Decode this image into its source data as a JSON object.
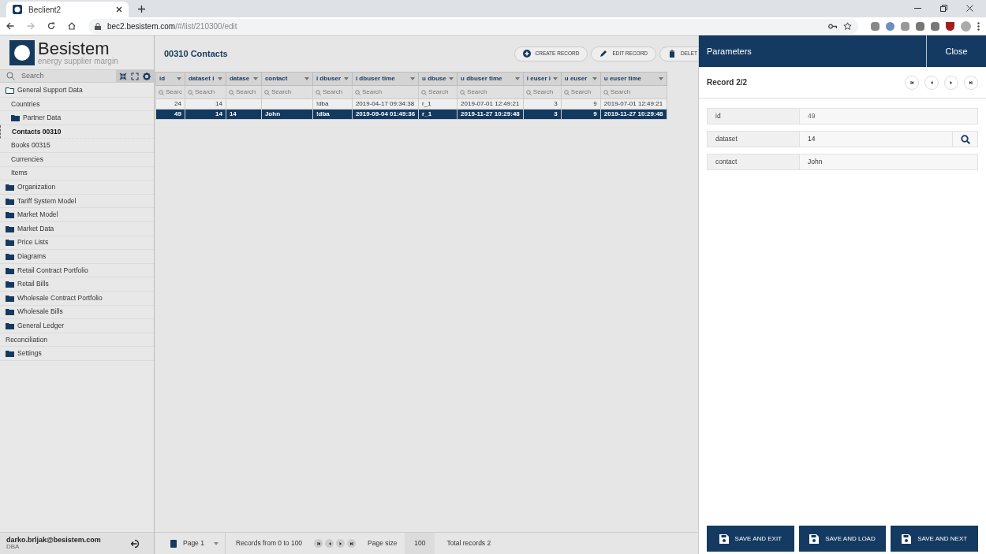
{
  "browser": {
    "tab_title": "Beclient2",
    "url_host": "bec2.besistem.com",
    "url_path": "/#/list/210300/edit"
  },
  "logo": {
    "name": "Besistem",
    "tagline": "energy supplier margin"
  },
  "sidebar": {
    "search_placeholder": "Search",
    "tree": [
      {
        "label": "General Support Data",
        "kind": "folder",
        "expanded": true,
        "selected": false,
        "children": [
          {
            "label": "Countries",
            "kind": "leaf",
            "selected": false
          },
          {
            "label": "Partner Data",
            "kind": "folder",
            "expanded": false,
            "selected": false
          },
          {
            "label": "Contacts 00310",
            "kind": "leaf",
            "selected": true
          },
          {
            "label": "Books 00315",
            "kind": "leaf",
            "selected": false
          },
          {
            "label": "Currencies",
            "kind": "leaf",
            "selected": false
          },
          {
            "label": "Items",
            "kind": "leaf",
            "selected": false
          }
        ]
      },
      {
        "label": "Organization",
        "kind": "folder",
        "expanded": false,
        "selected": false
      },
      {
        "label": "Tariff System Model",
        "kind": "folder",
        "expanded": false,
        "selected": false
      },
      {
        "label": "Market Model",
        "kind": "folder",
        "expanded": false,
        "selected": false
      },
      {
        "label": "Market Data",
        "kind": "folder",
        "expanded": false,
        "selected": false
      },
      {
        "label": "Price Lists",
        "kind": "folder",
        "expanded": false,
        "selected": false
      },
      {
        "label": "Diagrams",
        "kind": "folder",
        "expanded": false,
        "selected": false
      },
      {
        "label": "Retail Contract Portfolio",
        "kind": "folder",
        "expanded": false,
        "selected": false
      },
      {
        "label": "Retail Bills",
        "kind": "folder",
        "expanded": false,
        "selected": false
      },
      {
        "label": "Wholesale Contract Portfolio",
        "kind": "folder",
        "expanded": false,
        "selected": false
      },
      {
        "label": "Wholesale Bills",
        "kind": "folder",
        "expanded": false,
        "selected": false
      },
      {
        "label": "General Ledger",
        "kind": "folder",
        "expanded": false,
        "selected": false
      },
      {
        "label": "Reconciliation",
        "kind": "leaf",
        "selected": false
      },
      {
        "label": "Settings",
        "kind": "folder",
        "expanded": false,
        "selected": false
      }
    ],
    "user": {
      "email": "darko.brljak@besistem.com",
      "role": "DBA"
    }
  },
  "main": {
    "title": "00310 Contacts",
    "actions": [
      "CREATE RECORD",
      "EDIT RECORD",
      "DELET"
    ],
    "table": {
      "columns": [
        {
          "label": "id",
          "search": "Searc"
        },
        {
          "label": "dataset i",
          "search": "Search"
        },
        {
          "label": "datase",
          "search": "Search"
        },
        {
          "label": "contact",
          "search": "Search"
        },
        {
          "label": "i dbuser",
          "search": "Search"
        },
        {
          "label": "i dbuser time",
          "search": "Search"
        },
        {
          "label": "u dbuse",
          "search": "Search"
        },
        {
          "label": "u dbuser time",
          "search": "Search"
        },
        {
          "label": "i euser i",
          "search": "Search"
        },
        {
          "label": "u euser",
          "search": "Search"
        },
        {
          "label": "u euser time",
          "search": "Search"
        }
      ],
      "rows": [
        {
          "selected": false,
          "cells": [
            "24",
            "14",
            "",
            "",
            "!dba",
            "2019-04-17 09:34:38",
            "r_1",
            "2019-07-01 12:49:21",
            "3",
            "9",
            "2019-07-01 12:49:21"
          ]
        },
        {
          "selected": true,
          "cells": [
            "49",
            "14",
            "14",
            "John",
            "!dba",
            "2019-09-04 01:49:36",
            "r_1",
            "2019-11-27 10:29:48",
            "3",
            "9",
            "2019-11-27 10:29:48"
          ]
        }
      ]
    },
    "footer": {
      "page": "Page 1",
      "records_range": "Records from 0 to 100",
      "page_size_label": "Page size",
      "page_size": "100",
      "total": "Total records 2"
    }
  },
  "panel": {
    "title": "Parameters",
    "close": "Close",
    "record": "Record 2/2",
    "fields": [
      {
        "label": "id",
        "value": "49",
        "kind": "readonly"
      },
      {
        "label": "dataset",
        "value": "14",
        "kind": "lookup"
      },
      {
        "label": "contact",
        "value": "John",
        "kind": "text"
      }
    ],
    "buttons": [
      "SAVE AND EXIT",
      "SAVE AND LOAD",
      "SAVE AND NEXT"
    ]
  }
}
